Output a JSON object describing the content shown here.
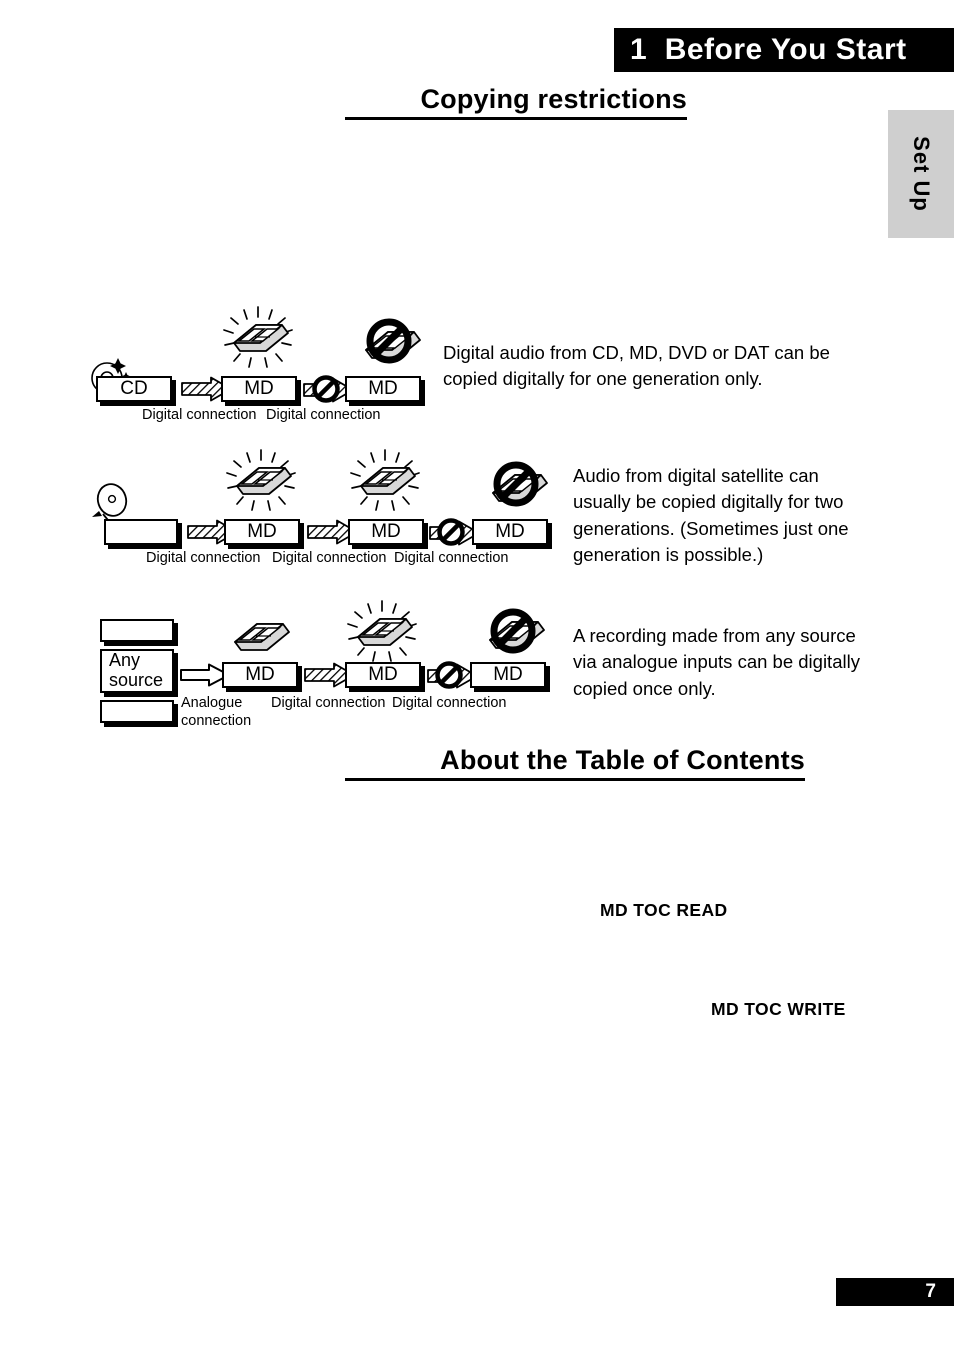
{
  "chapter": {
    "number": "1",
    "title": "Before You Start"
  },
  "side_tab": {
    "label": "Set Up"
  },
  "headings": {
    "copying": "Copying restrictions",
    "toc": "About the Table of Contents"
  },
  "diagrams": [
    {
      "id": "row-1",
      "source_icon": "cd-sparkle-icon",
      "nodes": [
        "CD",
        "MD",
        "MD"
      ],
      "arrows": [
        {
          "style": "hatched",
          "blocked": false
        },
        {
          "style": "hatched",
          "blocked": true
        }
      ],
      "connection_labels": [
        "Digital connection",
        "Digital connection"
      ],
      "disc_states": [
        "none",
        "shining",
        "prohibited"
      ]
    },
    {
      "id": "row-2",
      "source_icon": "satellite-dish-icon",
      "nodes": [
        "",
        "MD",
        "MD",
        "MD"
      ],
      "arrows": [
        {
          "style": "hatched",
          "blocked": false
        },
        {
          "style": "hatched",
          "blocked": false
        },
        {
          "style": "hatched",
          "blocked": true
        }
      ],
      "connection_labels": [
        "Digital connection",
        "Digital connection",
        "Digital connection"
      ],
      "disc_states": [
        "none",
        "shining",
        "shining",
        "prohibited"
      ]
    },
    {
      "id": "row-3",
      "source_icon": "stacked-source-boxes",
      "source_label_line1": "Any",
      "source_label_line2": "source",
      "nodes": [
        "Any source",
        "MD",
        "MD",
        "MD"
      ],
      "arrows": [
        {
          "style": "hollow",
          "blocked": false
        },
        {
          "style": "hatched",
          "blocked": false
        },
        {
          "style": "hatched",
          "blocked": true
        }
      ],
      "connection_labels": [
        "Analogue connection",
        "Digital connection",
        "Digital connection"
      ],
      "disc_states": [
        "none",
        "plain",
        "shining",
        "prohibited"
      ]
    }
  ],
  "paragraphs": {
    "p1": "Digital audio from CD, MD, DVD or DAT can be copied digitally for one generation only.",
    "p2": "Audio from digital satellite can usually be copied digitally for two generations. (Sometimes just one generation is possible.)",
    "p3": "A recording made from any source via analogue inputs can be digitally copied once only."
  },
  "toc_terms": {
    "read": "MD TOC READ",
    "write": "MD TOC WRITE"
  },
  "footer": {
    "page_number": "7"
  },
  "colors": {
    "banner_bg": "#000000",
    "banner_text": "#ffffff",
    "side_tab_bg": "#cfcfcf",
    "ink": "#000000",
    "paper": "#ffffff"
  }
}
